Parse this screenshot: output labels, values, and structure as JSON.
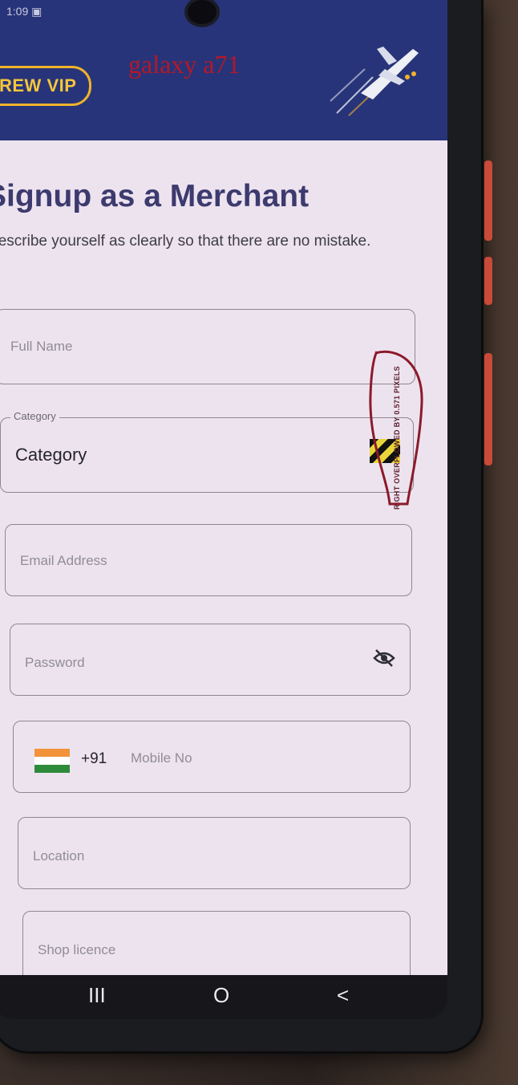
{
  "overlay_label": "galaxy a71",
  "status_bar": {
    "time": "1:09"
  },
  "header": {
    "badge": "REW VIP"
  },
  "page": {
    "title": "Signup as a Merchant",
    "subtitle": "Describe yourself as clearly so that there are no mistake."
  },
  "form": {
    "full_name": {
      "placeholder": "Full Name"
    },
    "category": {
      "label": "Category",
      "value": "Category"
    },
    "email": {
      "placeholder": "Email Address"
    },
    "password": {
      "placeholder": "Password"
    },
    "mobile": {
      "country_code": "+91",
      "placeholder": "Mobile No"
    },
    "location": {
      "placeholder": "Location"
    },
    "shop_licence": {
      "placeholder": "Shop licence"
    }
  },
  "overflow_warning": "RIGHT OVERFLOWED BY 0.571 PIXELS",
  "navbar": {
    "recents": "III",
    "home": "O",
    "back": "<"
  },
  "colors": {
    "header": "#283479",
    "accent": "#f0b32a",
    "title": "#3c3a6e",
    "annotation": "#8b1a2a"
  }
}
